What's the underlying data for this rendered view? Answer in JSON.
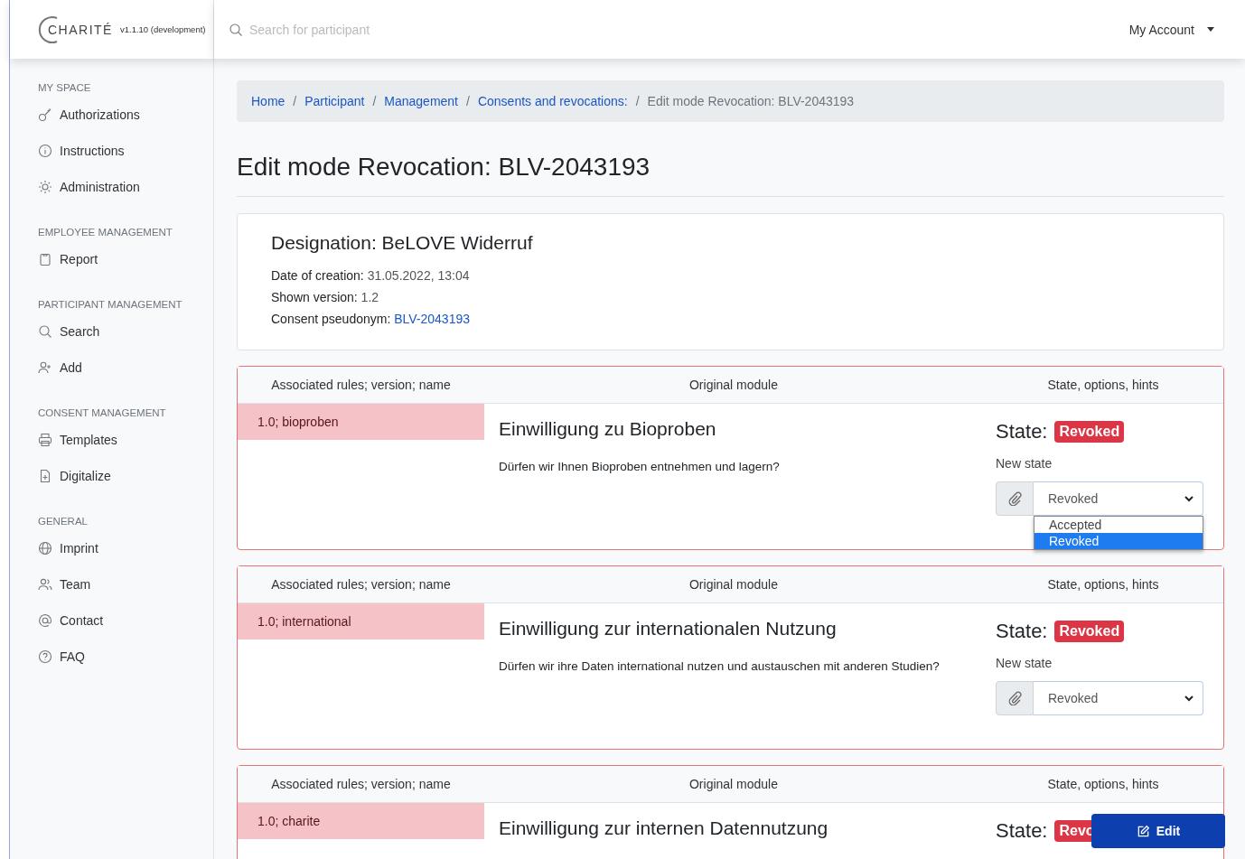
{
  "header": {
    "logo": "CHARITÉ",
    "version": "v1.1.10 (development)",
    "search": {
      "placeholder": "Search for participant"
    },
    "account": "My Account"
  },
  "sidebar": {
    "sections": [
      {
        "title": "MY SPACE",
        "items": [
          {
            "label": "Authorizations"
          },
          {
            "label": "Instructions"
          },
          {
            "label": "Administration"
          }
        ]
      },
      {
        "title": "EMPLOYEE MANAGEMENT",
        "items": [
          {
            "label": "Report"
          }
        ]
      },
      {
        "title": "PARTICIPANT MANAGEMENT",
        "items": [
          {
            "label": "Search"
          },
          {
            "label": "Add"
          }
        ]
      },
      {
        "title": "CONSENT MANAGEMENT",
        "items": [
          {
            "label": "Templates"
          },
          {
            "label": "Digitalize"
          }
        ]
      },
      {
        "title": "GENERAL",
        "items": [
          {
            "label": "Imprint"
          },
          {
            "label": "Team"
          },
          {
            "label": "Contact"
          },
          {
            "label": "FAQ"
          }
        ]
      }
    ]
  },
  "breadcrumb": [
    {
      "label": "Home",
      "link": true
    },
    {
      "separator": "/",
      "label": "Participant",
      "link": true
    },
    {
      "separator": "/",
      "label": "Management",
      "link": true
    },
    {
      "separator": "/",
      "label": "Consents and revocations:",
      "link": true
    },
    {
      "separator": "/",
      "label": "Edit mode Revocation: BLV-2043193",
      "link": false
    }
  ],
  "page_title": "Edit mode Revocation: BLV-2043193",
  "info": {
    "designation": "Designation: BeLOVE Widerruf",
    "fields": [
      {
        "label": "Date of creation:",
        "value": "31.05.2022, 13:04",
        "link": false
      },
      {
        "label": "Shown version:",
        "value": "1.2",
        "link": false
      },
      {
        "label": "Consent pseudonym:",
        "value": "BLV-2043193",
        "link": true
      }
    ]
  },
  "modules": [
    {
      "columns": [
        "Associated rules; version; name",
        "Original module",
        "State, options, hints"
      ],
      "rules": "1.0; bioproben",
      "title": "Einwilligung zu Bioproben",
      "description": "Dürfen wir Ihnen Bioproben entnehmen und lagern?",
      "state_label": "State:",
      "state": "Revoked",
      "new_state_label": "New state",
      "select_value": "Revoked",
      "options": [
        {
          "label": "Accepted",
          "selected": false
        },
        {
          "label": "Revoked",
          "selected": true
        }
      ]
    },
    {
      "columns": [
        "Associated rules; version; name",
        "Original module",
        "State, options, hints"
      ],
      "rules": "1.0; international",
      "title": "Einwilligung zur internationalen Nutzung",
      "description": "Dürfen wir ihre Daten international nutzen und austauschen mit anderen Studien?",
      "state_label": "State:",
      "state": "Revoked",
      "new_state_label": "New state",
      "select_value": "Revoked"
    },
    {
      "columns": [
        "Associated rules; version; name",
        "Original module",
        "State, options, hints"
      ],
      "rules": "1.0; charite",
      "title": "Einwilligung zur internen Datennutzung",
      "state_label": "State:",
      "state": "Revo"
    }
  ],
  "edit_button": "Edit"
}
